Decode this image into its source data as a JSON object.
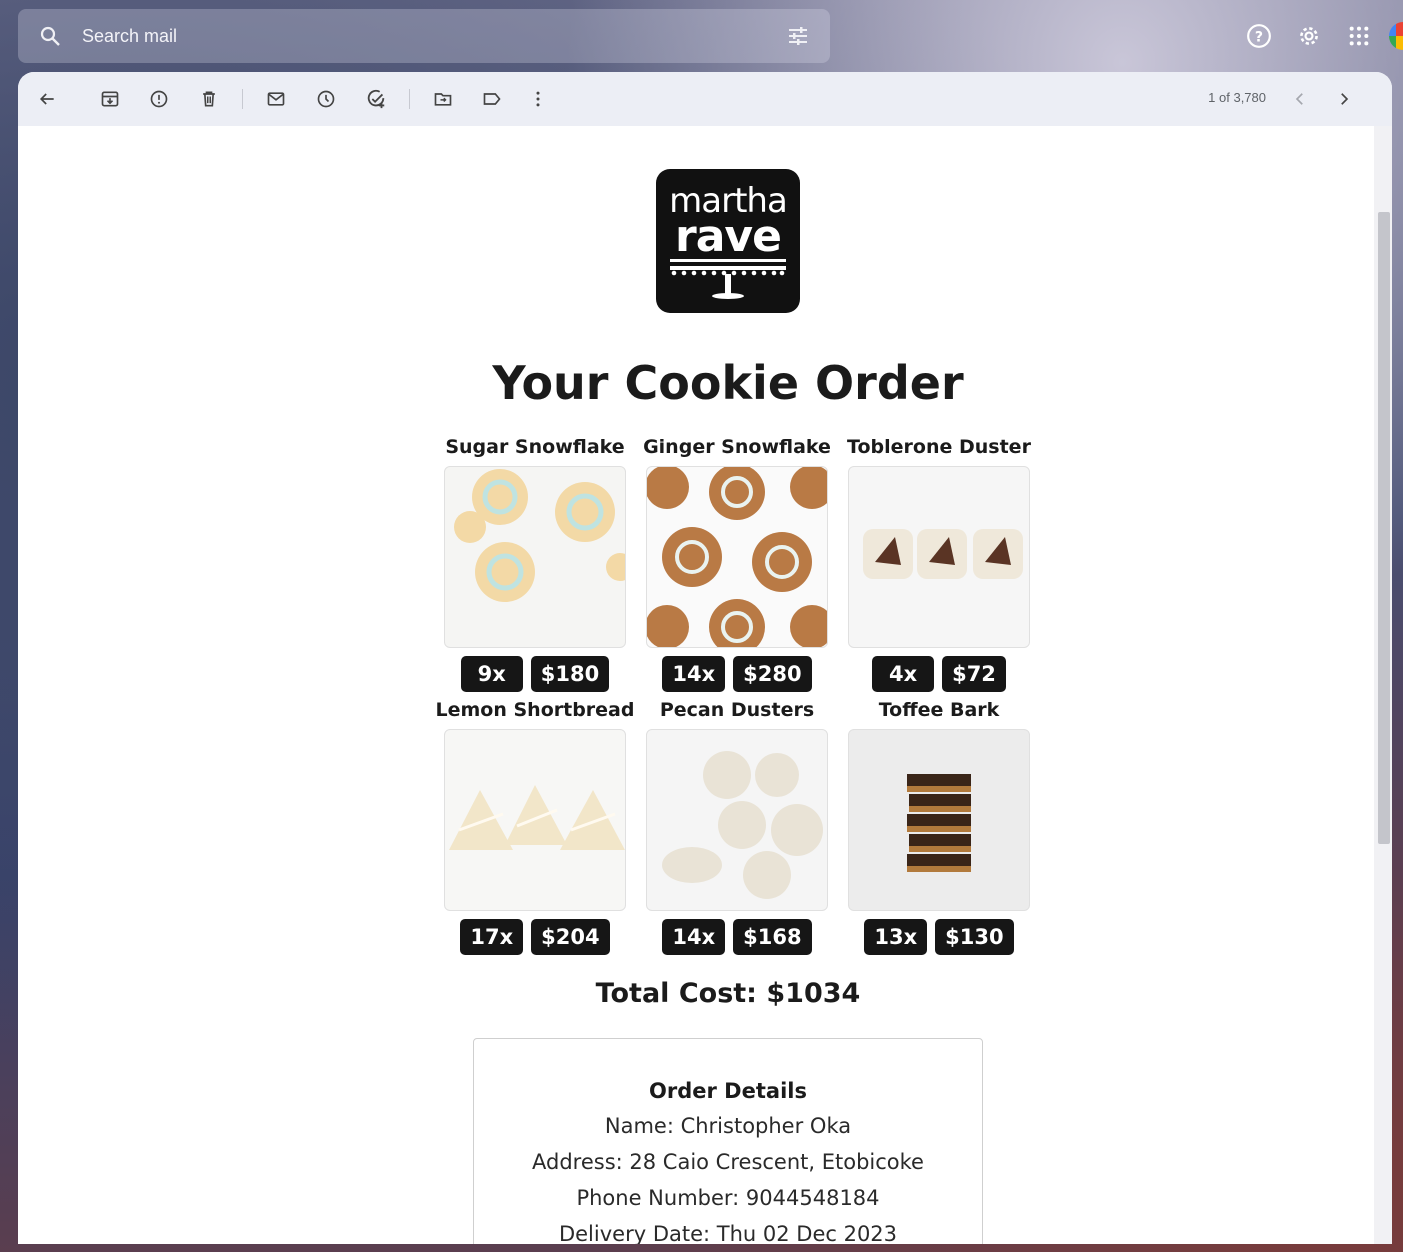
{
  "search": {
    "placeholder": "Search mail"
  },
  "toolbar": {
    "pager": "1 of 3,780"
  },
  "logo": {
    "line1": "martha",
    "line2": "rave"
  },
  "email": {
    "title": "Your Cookie Order",
    "items": [
      {
        "name": "Sugar Snowflake",
        "qty": "9x",
        "price": "$180"
      },
      {
        "name": "Ginger Snowflake",
        "qty": "14x",
        "price": "$280"
      },
      {
        "name": "Toblerone Duster",
        "qty": "4x",
        "price": "$72"
      },
      {
        "name": "Lemon Shortbread",
        "qty": "17x",
        "price": "$204"
      },
      {
        "name": "Pecan Dusters",
        "qty": "14x",
        "price": "$168"
      },
      {
        "name": "Toffee Bark",
        "qty": "13x",
        "price": "$130"
      }
    ],
    "total": "Total Cost: $1034",
    "details": {
      "heading": "Order Details",
      "name": "Name: Christopher Oka",
      "address": "Address: 28 Caio Crescent, Etobicoke",
      "phone": "Phone Number: 9044548184",
      "delivery": "Delivery Date: Thu 02 Dec 2023"
    }
  },
  "icons": {
    "search": "search-icon",
    "tune": "tune-icon",
    "help": "help-icon",
    "settings": "gear-icon",
    "apps": "apps-grid-icon",
    "back": "arrow-back-icon",
    "archive": "archive-icon",
    "spam": "report-spam-icon",
    "delete": "trash-icon",
    "unread": "mark-unread-icon",
    "snooze": "snooze-icon",
    "task": "add-task-icon",
    "move": "move-to-icon",
    "label": "label-icon",
    "more": "more-vert-icon",
    "prev": "chevron-left-icon",
    "next": "chevron-right-icon"
  }
}
